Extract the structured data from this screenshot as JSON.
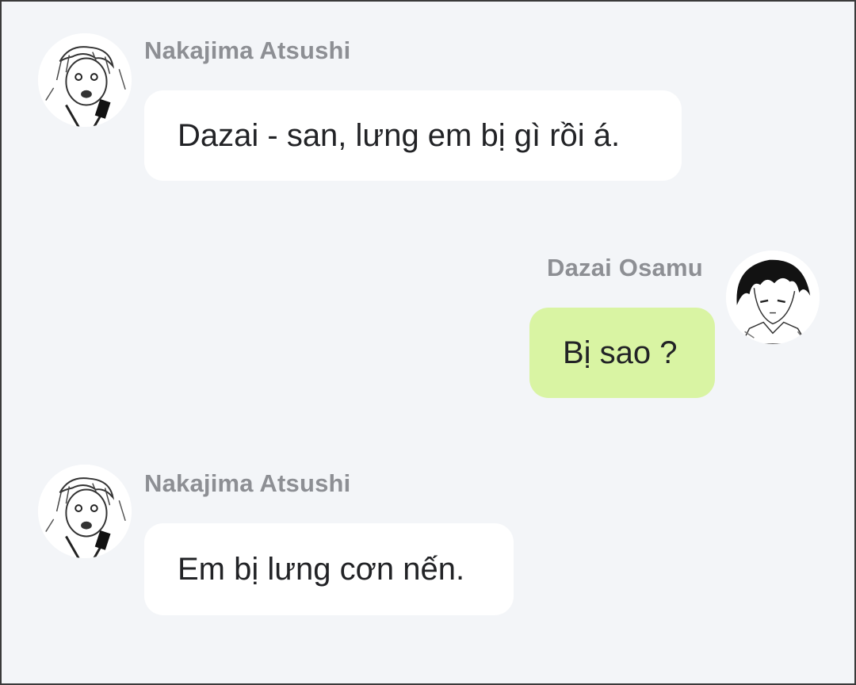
{
  "messages": [
    {
      "sender": "Nakajima Atsushi",
      "text": "Dazai - san, lưng em bị gì rồi á.",
      "avatar_icon": "atsushi-avatar-icon",
      "direction": "incoming"
    },
    {
      "sender": "Dazai Osamu",
      "text": "Bị sao ?",
      "avatar_icon": "dazai-avatar-icon",
      "direction": "outgoing"
    },
    {
      "sender": "Nakajima Atsushi",
      "text": "Em bị lưng cơn nến.",
      "avatar_icon": "atsushi-avatar-icon",
      "direction": "incoming"
    }
  ],
  "colors": {
    "background": "#f3f5f8",
    "incoming_bubble": "#ffffff",
    "outgoing_bubble": "#d9f4a3",
    "sender_name": "#8d8f94",
    "message_text": "#222326"
  }
}
